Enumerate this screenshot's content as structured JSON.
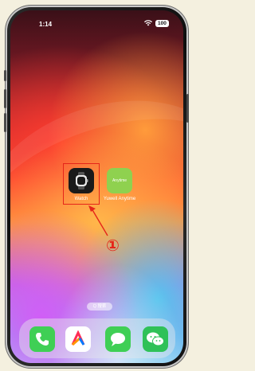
{
  "status_bar": {
    "time": "1:14",
    "battery": "100"
  },
  "home_apps": [
    {
      "label": "Watch",
      "icon": "watch-icon",
      "highlighted": true
    },
    {
      "label": "Yuwell Anytime",
      "icon": "yuwell-icon",
      "icon_text": "Anytime",
      "highlighted": false
    }
  ],
  "annotation": {
    "step_number": "①",
    "color": "#e5251a"
  },
  "search_label": "Q 搜索",
  "dock": [
    {
      "name": "phone",
      "icon": "phone-icon"
    },
    {
      "name": "maps",
      "icon": "maps-icon"
    },
    {
      "name": "messages",
      "icon": "messages-icon"
    },
    {
      "name": "wechat",
      "icon": "wechat-icon"
    }
  ]
}
